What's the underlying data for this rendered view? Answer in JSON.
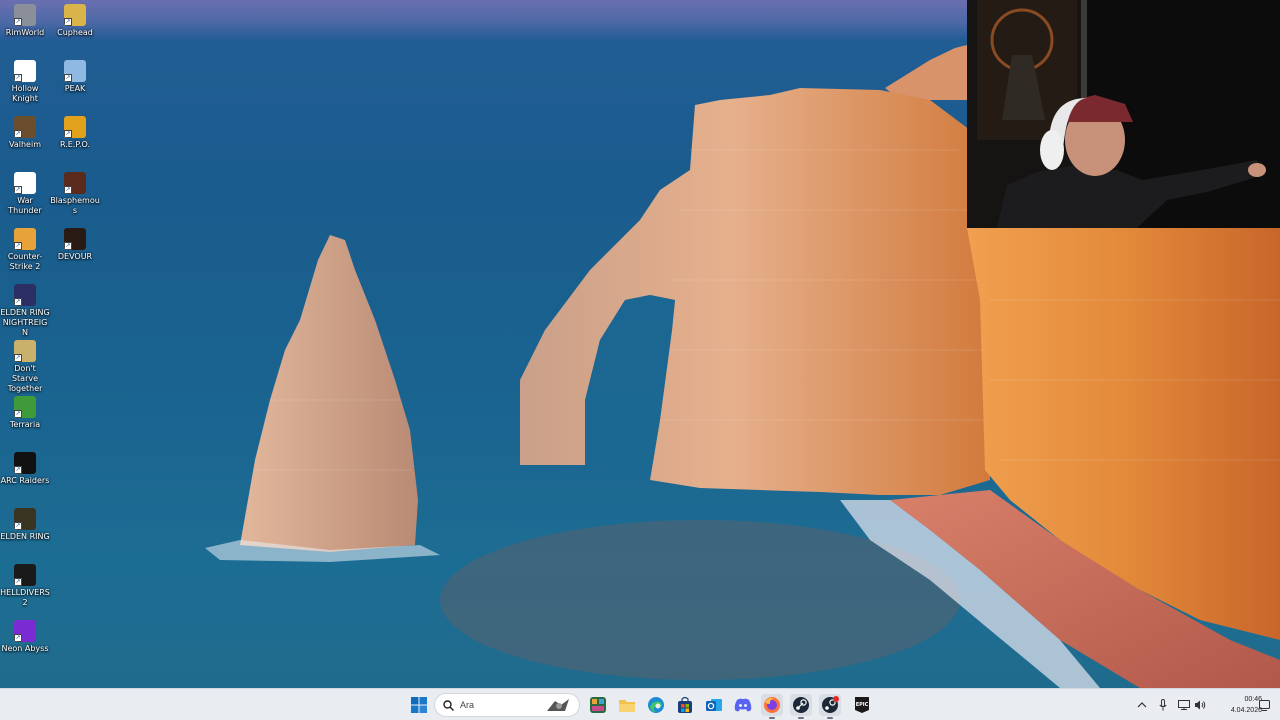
{
  "desktop": {
    "icons": [
      {
        "label": "RimWorld",
        "icon": "rimworld-icon",
        "color": "#8a8f99"
      },
      {
        "label": "Cuphead",
        "icon": "cuphead-icon",
        "color": "#d9b44a"
      },
      {
        "label": "Hollow Knight",
        "icon": "hollow-knight-icon",
        "color": "#ffffff"
      },
      {
        "label": "PEAK",
        "icon": "peak-icon",
        "color": "#8fb9e0"
      },
      {
        "label": "Valheim",
        "icon": "valheim-icon",
        "color": "#6b4e2e"
      },
      {
        "label": "R.E.P.O.",
        "icon": "repo-icon",
        "color": "#e2a11b"
      },
      {
        "label": "War Thunder",
        "icon": "war-thunder-icon",
        "color": "#ffffff"
      },
      {
        "label": "Blasphemous",
        "icon": "blasphemous-icon",
        "color": "#5a2a1c"
      },
      {
        "label": "Counter-Strike 2",
        "icon": "counter-strike-icon",
        "color": "#e8a23a"
      },
      {
        "label": "DEVOUR",
        "icon": "devour-icon",
        "color": "#2a1a14"
      },
      {
        "label": "ELDEN RING NIGHTREIGN",
        "icon": "elden-ring-nightreign-icon",
        "color": "#2b2f63"
      },
      {
        "label": "Don't Starve Together",
        "icon": "dont-starve-icon",
        "color": "#c9b16b"
      },
      {
        "label": "Terraria",
        "icon": "terraria-icon",
        "color": "#3f9b3a"
      },
      {
        "label": "ARC Raiders",
        "icon": "arc-raiders-icon",
        "color": "#111111"
      },
      {
        "label": "ELDEN RING",
        "icon": "elden-ring-icon",
        "color": "#3a3423"
      },
      {
        "label": "HELLDIVERS 2",
        "icon": "helldivers-icon",
        "color": "#1a1a1a"
      },
      {
        "label": "Neon Abyss",
        "icon": "neon-abyss-icon",
        "color": "#7a2bd1"
      }
    ]
  },
  "taskbar": {
    "search_placeholder": "Ara",
    "apps": [
      {
        "name": "start-button",
        "icon": "windows-icon"
      },
      {
        "name": "widgets-button",
        "icon": "widgets-icon"
      },
      {
        "name": "file-explorer-button",
        "icon": "folder-icon"
      },
      {
        "name": "edge-button",
        "icon": "edge-icon"
      },
      {
        "name": "store-button",
        "icon": "store-icon"
      },
      {
        "name": "outlook-button",
        "icon": "outlook-icon"
      },
      {
        "name": "discord-button",
        "icon": "discord-icon"
      },
      {
        "name": "firefox-button",
        "icon": "firefox-icon"
      },
      {
        "name": "steam-button",
        "icon": "steam-icon"
      },
      {
        "name": "steam-notify-button",
        "icon": "steam-badge-icon"
      },
      {
        "name": "epic-games-button",
        "icon": "epic-games-icon"
      }
    ],
    "tray": {
      "time": "00:46",
      "date": "4.04.2026"
    }
  },
  "colors": {
    "taskbar_bg": "#e9ecf1",
    "sea": "#1a5b8e",
    "cliff": "#e08a4a"
  }
}
